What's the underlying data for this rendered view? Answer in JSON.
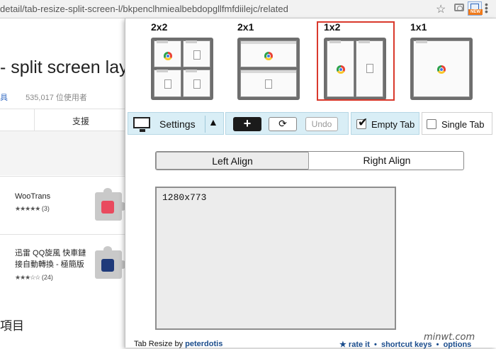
{
  "browser": {
    "url": "detail/tab-resize-split-screen-l/bkpenclhmiealbebdopgllfmfdiilejc/related",
    "icons": [
      "star-icon",
      "camera-icon",
      "extension-new-icon",
      "menu-icon"
    ],
    "ext_badge": "NEW"
  },
  "background_page": {
    "title": "- split screen layo",
    "meta_link": "具",
    "users": "535,017 位使用者",
    "support_tab": "支援",
    "cards": [
      {
        "name": "WooTrans",
        "stars": "★★★★★",
        "count": "(3)",
        "icon_color": "#e94a5e"
      },
      {
        "name": "迅雷 QQ旋風 快車鏈接自動轉換 - 極簡版",
        "stars": "★★★☆☆",
        "count": "(24)",
        "icon_color": "#1f3a7a"
      }
    ],
    "section_heading": "項目"
  },
  "popup": {
    "layouts": [
      {
        "label": "2x2"
      },
      {
        "label": "2x1"
      },
      {
        "label": "1x2",
        "selected": true
      },
      {
        "label": "1x1"
      }
    ],
    "toolbar": {
      "settings_label": "Settings",
      "add_label": "+",
      "refresh_label": "⟳",
      "undo_label": "Undo",
      "empty_tab_label": "Empty Tab",
      "empty_tab_checked": true,
      "single_tab_label": "Single Tab",
      "single_tab_checked": false
    },
    "align": {
      "left_label": "Left Align",
      "right_label": "Right Align",
      "selected": "left"
    },
    "resolution": "1280x773",
    "footer": {
      "prefix": "Tab Resize by",
      "author": "peterdotis",
      "rate": "★ rate it",
      "shortcuts": "shortcut keys",
      "options": "options"
    }
  },
  "watermark": "minwt.com",
  "colors": {
    "selected_border": "#d9392c",
    "toolbar_bg": "#d9eef6",
    "link": "#1a4c8c"
  }
}
